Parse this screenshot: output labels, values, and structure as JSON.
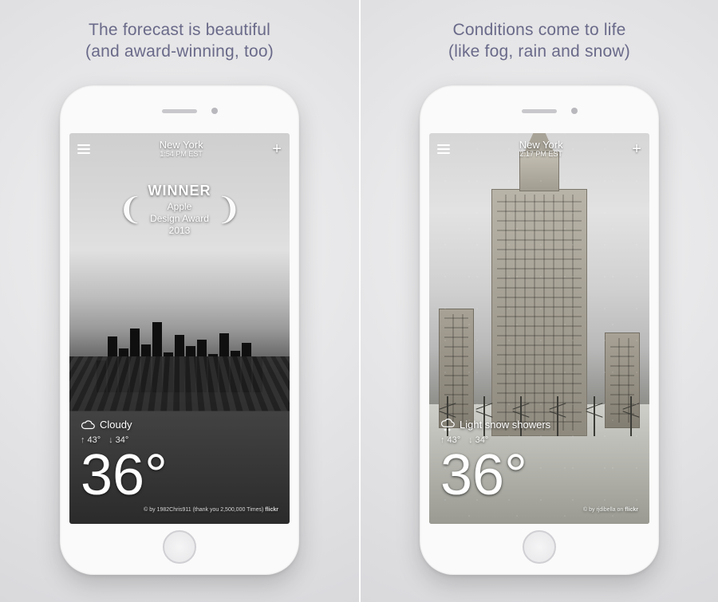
{
  "panels": [
    {
      "tagline_l1": "The forecast is beautiful",
      "tagline_l2": "(and award-winning, too)",
      "location": "New York",
      "time": "1:54 PM EST",
      "award_title": "WINNER",
      "award_sub1": "Apple",
      "award_sub2": "Design Award",
      "award_sub3": "2013",
      "condition": "Cloudy",
      "high_label": "↑",
      "high": "43°",
      "low_label": "↓",
      "low": "34°",
      "temp": "36°",
      "credit_prefix": "© by 1982Chris911 (thank you 2,500,000 Times) ",
      "credit_brand": "flickr"
    },
    {
      "tagline_l1": "Conditions come to life",
      "tagline_l2": "(like fog, rain and snow)",
      "location": "New York",
      "time": "2:17 PM EST",
      "condition": "Light snow showers",
      "high_label": "↑",
      "high": "43°",
      "low_label": "↓",
      "low": "34°",
      "temp": "36°",
      "credit_prefix": "© by rjdibella on ",
      "credit_brand": "flickr"
    }
  ]
}
